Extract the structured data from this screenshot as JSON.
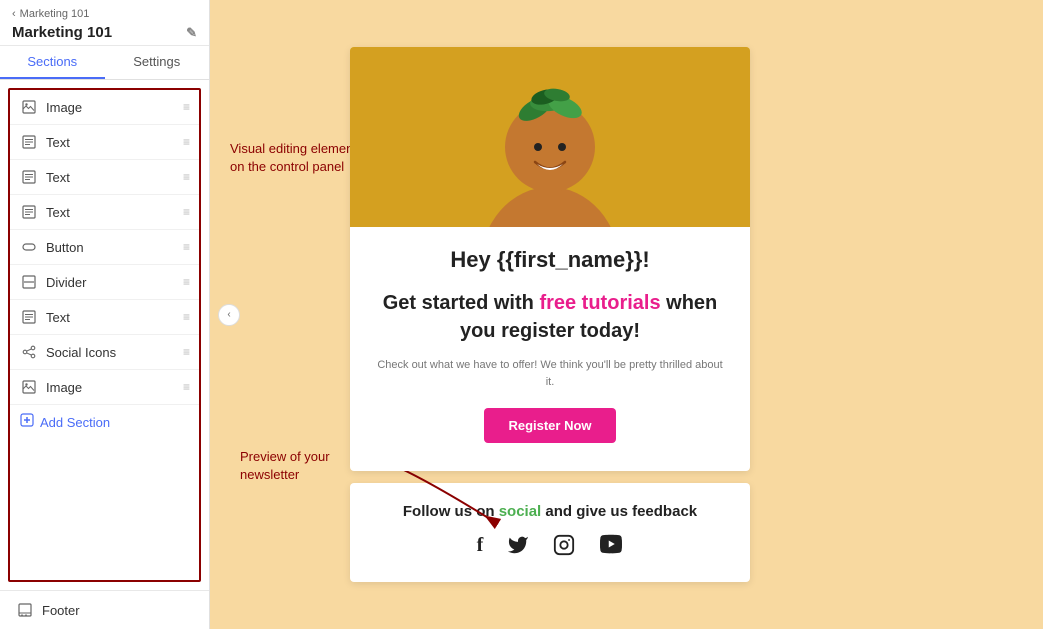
{
  "sidebar": {
    "back_label": "Marketing 101",
    "title": "Marketing 101",
    "tabs": [
      {
        "id": "sections",
        "label": "Sections",
        "active": true
      },
      {
        "id": "settings",
        "label": "Settings",
        "active": false
      }
    ],
    "sections": [
      {
        "id": "image-1",
        "label": "Image",
        "icon": "image"
      },
      {
        "id": "text-1",
        "label": "Text",
        "icon": "text"
      },
      {
        "id": "text-2",
        "label": "Text",
        "icon": "text"
      },
      {
        "id": "text-3",
        "label": "Text",
        "icon": "text"
      },
      {
        "id": "button-1",
        "label": "Button",
        "icon": "button"
      },
      {
        "id": "divider-1",
        "label": "Divider",
        "icon": "divider"
      },
      {
        "id": "text-4",
        "label": "Text",
        "icon": "text"
      },
      {
        "id": "social-1",
        "label": "Social Icons",
        "icon": "social"
      },
      {
        "id": "image-2",
        "label": "Image",
        "icon": "image"
      }
    ],
    "add_section_label": "Add Section",
    "footer_label": "Footer"
  },
  "annotations": {
    "arrow1_text": "Visual editing elements on the control panel",
    "arrow2_text": "Preview of your newsletter"
  },
  "newsletter": {
    "greeting": "Hey {{first_name}}!",
    "promo_line1": "Get started with ",
    "promo_highlight1": "free tutorials",
    "promo_line2": " when you register today!",
    "sub_text": "Check out what we have to offer! We think you'll be pretty thrilled about it.",
    "cta_button": "Register Now"
  },
  "social_section": {
    "follow_text_before": "Follow us on ",
    "follow_highlight": "social",
    "follow_text_after": " and give us feedback",
    "icons": [
      "f",
      "🐦",
      "📷",
      "▶"
    ]
  }
}
